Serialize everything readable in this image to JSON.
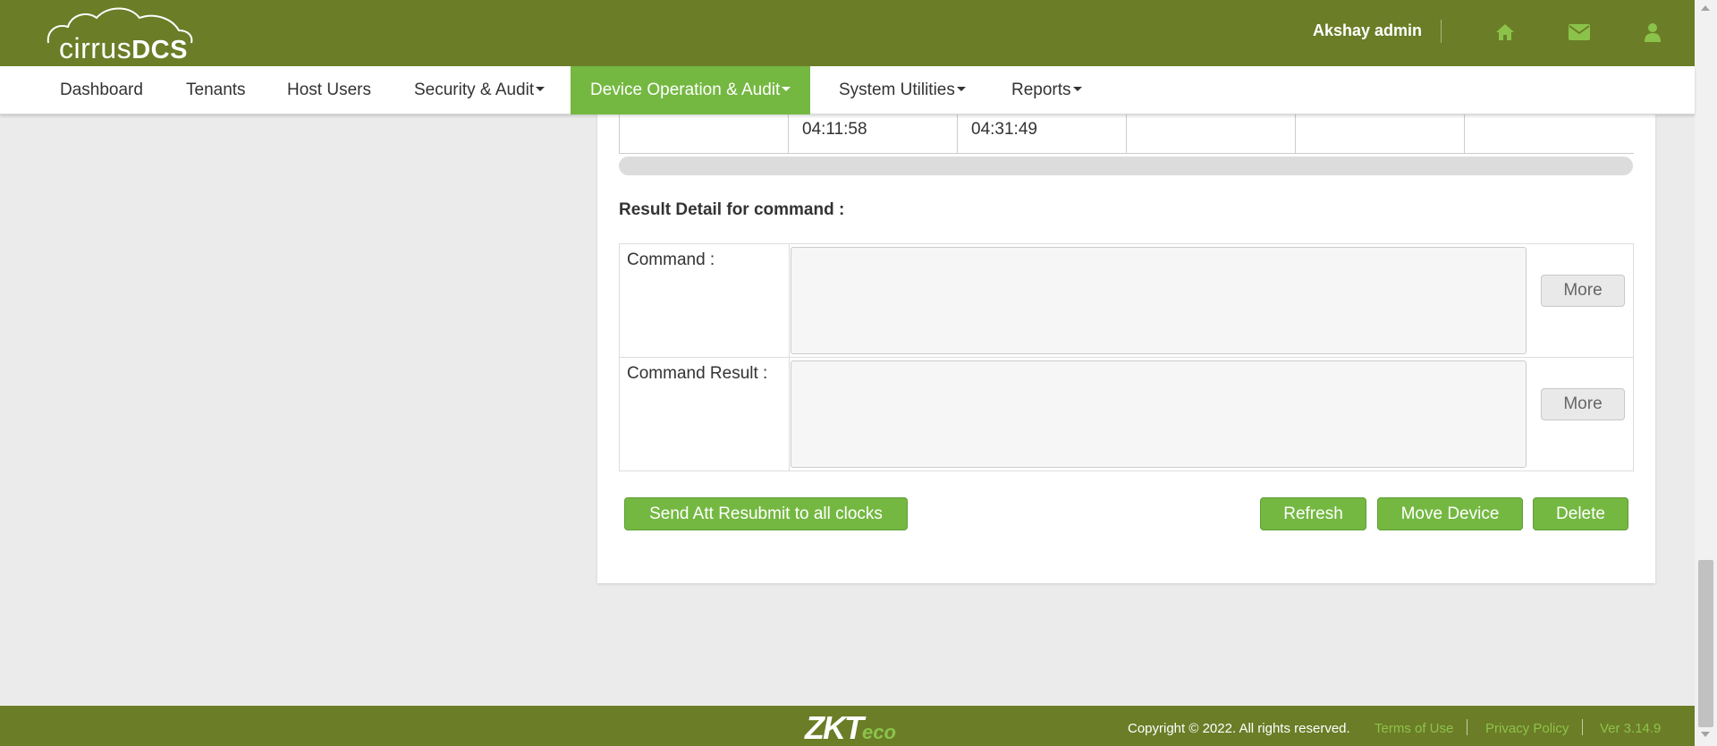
{
  "header": {
    "logo_prefix": "cirrus",
    "logo_suffix": "DCS",
    "user_name": "Akshay admin",
    "icons": [
      "home-icon",
      "mail-icon",
      "user-icon"
    ]
  },
  "nav": {
    "items": [
      {
        "label": "Dashboard"
      },
      {
        "label": "Tenants"
      },
      {
        "label": "Host Users"
      },
      {
        "label": "Security & Audit"
      },
      {
        "label": "Device Operation & Audit"
      },
      {
        "label": "System Utilities"
      },
      {
        "label": "Reports"
      }
    ],
    "active": "Device Operation & Audit"
  },
  "table": {
    "partial_row": [
      "",
      "04:11:58",
      "04:31:49",
      "",
      "",
      ""
    ]
  },
  "result": {
    "title": "Result Detail for command :",
    "command_label": "Command :",
    "command_value": "",
    "result_label": "Command Result :",
    "result_value": "",
    "more_label": "More"
  },
  "actions": {
    "resubmit": "Send Att Resubmit to all clocks",
    "refresh": "Refresh",
    "move_device": "Move Device",
    "delete": "Delete"
  },
  "footer": {
    "brand_main": "ZKT",
    "brand_eco": "eco",
    "copyright": "Copyright © 2022. All rights reserved.",
    "terms": "Terms of Use",
    "privacy": "Privacy Policy",
    "version": "Ver 3.14.9"
  },
  "colors": {
    "header_bg": "#6b7d27",
    "accent_green": "#74b842",
    "link_green": "#8fc24a",
    "page_bg": "#ebebeb"
  }
}
